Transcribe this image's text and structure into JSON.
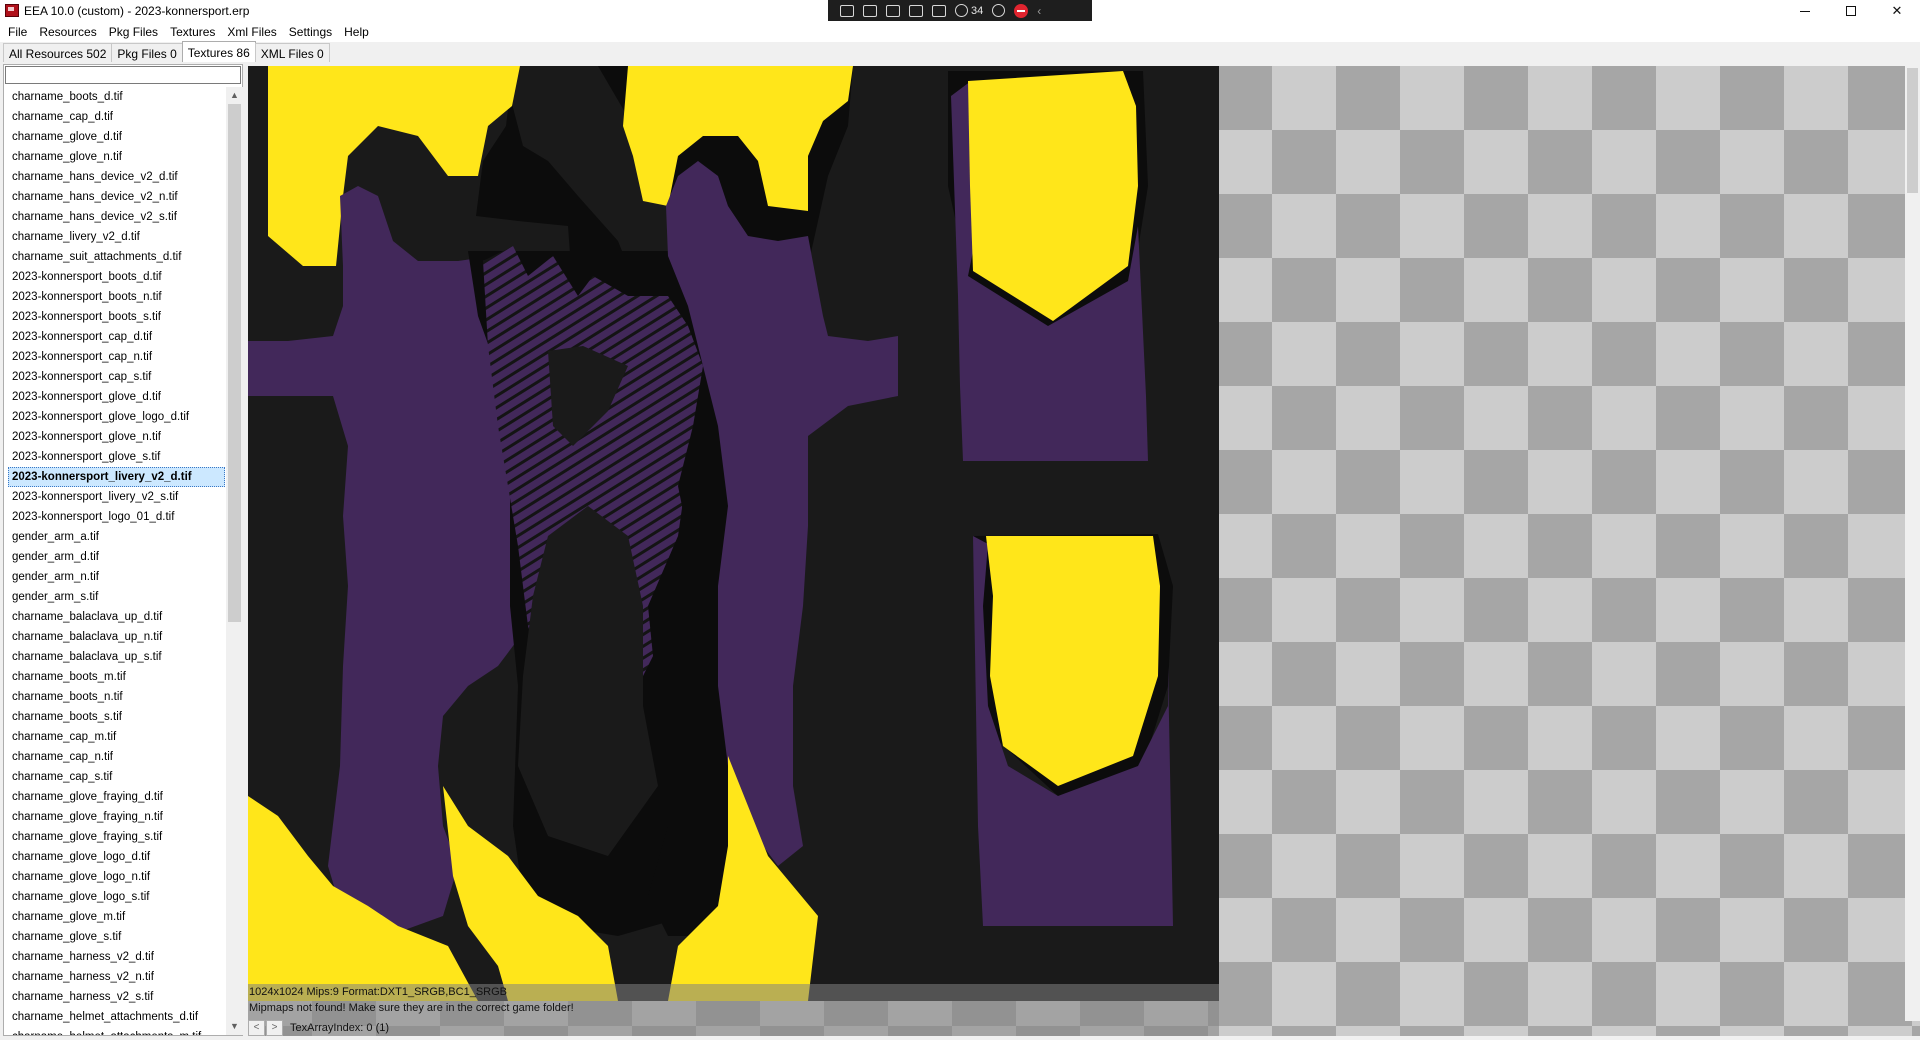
{
  "window": {
    "title": "EEA 10.0 (custom) - 2023-konnersport.erp",
    "close_glyph": "✕"
  },
  "float_toolbar": {
    "counter": "34"
  },
  "menu": [
    {
      "label": "File"
    },
    {
      "label": "Resources"
    },
    {
      "label": "Pkg Files"
    },
    {
      "label": "Textures"
    },
    {
      "label": "Xml Files"
    },
    {
      "label": "Settings"
    },
    {
      "label": "Help"
    }
  ],
  "tabs": [
    {
      "label": "All Resources 502"
    },
    {
      "label": "Pkg Files 0"
    },
    {
      "label": "Textures 86"
    },
    {
      "label": "XML Files 0"
    }
  ],
  "filter": {
    "value": ""
  },
  "files": [
    "charname_boots_d.tif",
    "charname_cap_d.tif",
    "charname_glove_d.tif",
    "charname_glove_n.tif",
    "charname_hans_device_v2_d.tif",
    "charname_hans_device_v2_n.tif",
    "charname_hans_device_v2_s.tif",
    "charname_livery_v2_d.tif",
    "charname_suit_attachments_d.tif",
    "2023-konnersport_boots_d.tif",
    "2023-konnersport_boots_n.tif",
    "2023-konnersport_boots_s.tif",
    "2023-konnersport_cap_d.tif",
    "2023-konnersport_cap_n.tif",
    "2023-konnersport_cap_s.tif",
    "2023-konnersport_glove_d.tif",
    "2023-konnersport_glove_logo_d.tif",
    "2023-konnersport_glove_n.tif",
    "2023-konnersport_glove_s.tif",
    "2023-konnersport_livery_v2_d.tif",
    "2023-konnersport_livery_v2_s.tif",
    "2023-konnersport_logo_01_d.tif",
    "gender_arm_a.tif",
    "gender_arm_d.tif",
    "gender_arm_n.tif",
    "gender_arm_s.tif",
    "charname_balaclava_up_d.tif",
    "charname_balaclava_up_n.tif",
    "charname_balaclava_up_s.tif",
    "charname_boots_m.tif",
    "charname_boots_n.tif",
    "charname_boots_s.tif",
    "charname_cap_m.tif",
    "charname_cap_n.tif",
    "charname_cap_s.tif",
    "charname_glove_fraying_d.tif",
    "charname_glove_fraying_n.tif",
    "charname_glove_fraying_s.tif",
    "charname_glove_logo_d.tif",
    "charname_glove_logo_n.tif",
    "charname_glove_logo_s.tif",
    "charname_glove_m.tif",
    "charname_glove_s.tif",
    "charname_harness_v2_d.tif",
    "charname_harness_v2_n.tif",
    "charname_harness_v2_s.tif",
    "charname_helmet_attachments_d.tif",
    "charname_helmet_attachments_m.tif"
  ],
  "selected_file": "2023-konnersport_livery_v2_d.tif",
  "texture_info": {
    "line1": "1024x1024 Mips:9 Format:DXT1_SRGB,BC1_SRGB",
    "line2": "Mipmaps not found! Make sure they are in the correct game folder!",
    "array_index": "TexArrayIndex: 0 (1)",
    "prev": "<",
    "next": ">"
  },
  "colors": {
    "texture_background": "#1a1a1a",
    "purple": "#42285a",
    "yellow": "#ffe61a",
    "outline": "#0c0c0c",
    "checker_dark": "#a6a6a6",
    "checker_light": "#cccccc",
    "selection": "#cce8ff"
  }
}
